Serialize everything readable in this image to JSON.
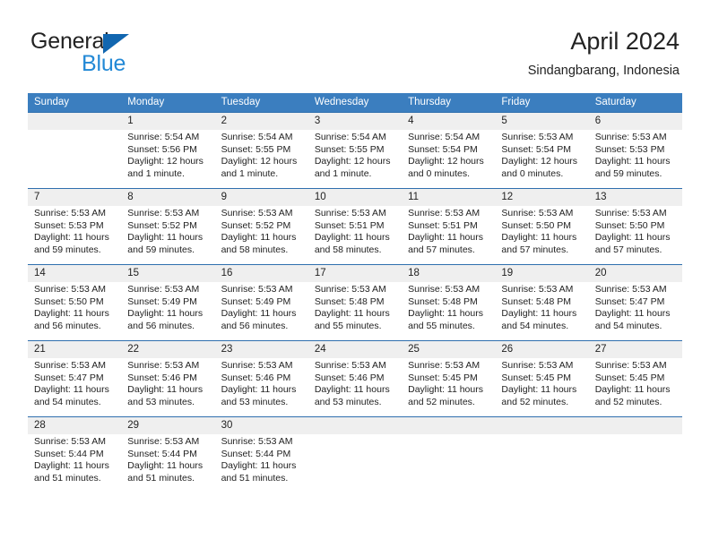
{
  "brand": {
    "line1": "General",
    "line2": "Blue",
    "triangle_color": "#1166b0",
    "blue_text_color": "#2389d6"
  },
  "header": {
    "title": "April 2024",
    "subtitle": "Sindangbarang, Indonesia"
  },
  "theme": {
    "header_row_bg": "#3b7ebf",
    "header_row_text": "#ffffff",
    "row_divider": "#2f6fae",
    "daynum_bg": "#efefef",
    "body_text": "#222222"
  },
  "weekdays": [
    "Sunday",
    "Monday",
    "Tuesday",
    "Wednesday",
    "Thursday",
    "Friday",
    "Saturday"
  ],
  "weeks": [
    [
      {
        "day": "",
        "blank": true,
        "sunrise": "",
        "sunset": "",
        "daylight_a": "",
        "daylight_b": ""
      },
      {
        "day": "1",
        "blank": false,
        "sunrise": "Sunrise: 5:54 AM",
        "sunset": "Sunset: 5:56 PM",
        "daylight_a": "Daylight: 12 hours",
        "daylight_b": "and 1 minute."
      },
      {
        "day": "2",
        "blank": false,
        "sunrise": "Sunrise: 5:54 AM",
        "sunset": "Sunset: 5:55 PM",
        "daylight_a": "Daylight: 12 hours",
        "daylight_b": "and 1 minute."
      },
      {
        "day": "3",
        "blank": false,
        "sunrise": "Sunrise: 5:54 AM",
        "sunset": "Sunset: 5:55 PM",
        "daylight_a": "Daylight: 12 hours",
        "daylight_b": "and 1 minute."
      },
      {
        "day": "4",
        "blank": false,
        "sunrise": "Sunrise: 5:54 AM",
        "sunset": "Sunset: 5:54 PM",
        "daylight_a": "Daylight: 12 hours",
        "daylight_b": "and 0 minutes."
      },
      {
        "day": "5",
        "blank": false,
        "sunrise": "Sunrise: 5:53 AM",
        "sunset": "Sunset: 5:54 PM",
        "daylight_a": "Daylight: 12 hours",
        "daylight_b": "and 0 minutes."
      },
      {
        "day": "6",
        "blank": false,
        "sunrise": "Sunrise: 5:53 AM",
        "sunset": "Sunset: 5:53 PM",
        "daylight_a": "Daylight: 11 hours",
        "daylight_b": "and 59 minutes."
      }
    ],
    [
      {
        "day": "7",
        "blank": false,
        "sunrise": "Sunrise: 5:53 AM",
        "sunset": "Sunset: 5:53 PM",
        "daylight_a": "Daylight: 11 hours",
        "daylight_b": "and 59 minutes."
      },
      {
        "day": "8",
        "blank": false,
        "sunrise": "Sunrise: 5:53 AM",
        "sunset": "Sunset: 5:52 PM",
        "daylight_a": "Daylight: 11 hours",
        "daylight_b": "and 59 minutes."
      },
      {
        "day": "9",
        "blank": false,
        "sunrise": "Sunrise: 5:53 AM",
        "sunset": "Sunset: 5:52 PM",
        "daylight_a": "Daylight: 11 hours",
        "daylight_b": "and 58 minutes."
      },
      {
        "day": "10",
        "blank": false,
        "sunrise": "Sunrise: 5:53 AM",
        "sunset": "Sunset: 5:51 PM",
        "daylight_a": "Daylight: 11 hours",
        "daylight_b": "and 58 minutes."
      },
      {
        "day": "11",
        "blank": false,
        "sunrise": "Sunrise: 5:53 AM",
        "sunset": "Sunset: 5:51 PM",
        "daylight_a": "Daylight: 11 hours",
        "daylight_b": "and 57 minutes."
      },
      {
        "day": "12",
        "blank": false,
        "sunrise": "Sunrise: 5:53 AM",
        "sunset": "Sunset: 5:50 PM",
        "daylight_a": "Daylight: 11 hours",
        "daylight_b": "and 57 minutes."
      },
      {
        "day": "13",
        "blank": false,
        "sunrise": "Sunrise: 5:53 AM",
        "sunset": "Sunset: 5:50 PM",
        "daylight_a": "Daylight: 11 hours",
        "daylight_b": "and 57 minutes."
      }
    ],
    [
      {
        "day": "14",
        "blank": false,
        "sunrise": "Sunrise: 5:53 AM",
        "sunset": "Sunset: 5:50 PM",
        "daylight_a": "Daylight: 11 hours",
        "daylight_b": "and 56 minutes."
      },
      {
        "day": "15",
        "blank": false,
        "sunrise": "Sunrise: 5:53 AM",
        "sunset": "Sunset: 5:49 PM",
        "daylight_a": "Daylight: 11 hours",
        "daylight_b": "and 56 minutes."
      },
      {
        "day": "16",
        "blank": false,
        "sunrise": "Sunrise: 5:53 AM",
        "sunset": "Sunset: 5:49 PM",
        "daylight_a": "Daylight: 11 hours",
        "daylight_b": "and 56 minutes."
      },
      {
        "day": "17",
        "blank": false,
        "sunrise": "Sunrise: 5:53 AM",
        "sunset": "Sunset: 5:48 PM",
        "daylight_a": "Daylight: 11 hours",
        "daylight_b": "and 55 minutes."
      },
      {
        "day": "18",
        "blank": false,
        "sunrise": "Sunrise: 5:53 AM",
        "sunset": "Sunset: 5:48 PM",
        "daylight_a": "Daylight: 11 hours",
        "daylight_b": "and 55 minutes."
      },
      {
        "day": "19",
        "blank": false,
        "sunrise": "Sunrise: 5:53 AM",
        "sunset": "Sunset: 5:48 PM",
        "daylight_a": "Daylight: 11 hours",
        "daylight_b": "and 54 minutes."
      },
      {
        "day": "20",
        "blank": false,
        "sunrise": "Sunrise: 5:53 AM",
        "sunset": "Sunset: 5:47 PM",
        "daylight_a": "Daylight: 11 hours",
        "daylight_b": "and 54 minutes."
      }
    ],
    [
      {
        "day": "21",
        "blank": false,
        "sunrise": "Sunrise: 5:53 AM",
        "sunset": "Sunset: 5:47 PM",
        "daylight_a": "Daylight: 11 hours",
        "daylight_b": "and 54 minutes."
      },
      {
        "day": "22",
        "blank": false,
        "sunrise": "Sunrise: 5:53 AM",
        "sunset": "Sunset: 5:46 PM",
        "daylight_a": "Daylight: 11 hours",
        "daylight_b": "and 53 minutes."
      },
      {
        "day": "23",
        "blank": false,
        "sunrise": "Sunrise: 5:53 AM",
        "sunset": "Sunset: 5:46 PM",
        "daylight_a": "Daylight: 11 hours",
        "daylight_b": "and 53 minutes."
      },
      {
        "day": "24",
        "blank": false,
        "sunrise": "Sunrise: 5:53 AM",
        "sunset": "Sunset: 5:46 PM",
        "daylight_a": "Daylight: 11 hours",
        "daylight_b": "and 53 minutes."
      },
      {
        "day": "25",
        "blank": false,
        "sunrise": "Sunrise: 5:53 AM",
        "sunset": "Sunset: 5:45 PM",
        "daylight_a": "Daylight: 11 hours",
        "daylight_b": "and 52 minutes."
      },
      {
        "day": "26",
        "blank": false,
        "sunrise": "Sunrise: 5:53 AM",
        "sunset": "Sunset: 5:45 PM",
        "daylight_a": "Daylight: 11 hours",
        "daylight_b": "and 52 minutes."
      },
      {
        "day": "27",
        "blank": false,
        "sunrise": "Sunrise: 5:53 AM",
        "sunset": "Sunset: 5:45 PM",
        "daylight_a": "Daylight: 11 hours",
        "daylight_b": "and 52 minutes."
      }
    ],
    [
      {
        "day": "28",
        "blank": false,
        "sunrise": "Sunrise: 5:53 AM",
        "sunset": "Sunset: 5:44 PM",
        "daylight_a": "Daylight: 11 hours",
        "daylight_b": "and 51 minutes."
      },
      {
        "day": "29",
        "blank": false,
        "sunrise": "Sunrise: 5:53 AM",
        "sunset": "Sunset: 5:44 PM",
        "daylight_a": "Daylight: 11 hours",
        "daylight_b": "and 51 minutes."
      },
      {
        "day": "30",
        "blank": false,
        "sunrise": "Sunrise: 5:53 AM",
        "sunset": "Sunset: 5:44 PM",
        "daylight_a": "Daylight: 11 hours",
        "daylight_b": "and 51 minutes."
      },
      {
        "day": "",
        "blank": true,
        "sunrise": "",
        "sunset": "",
        "daylight_a": "",
        "daylight_b": ""
      },
      {
        "day": "",
        "blank": true,
        "sunrise": "",
        "sunset": "",
        "daylight_a": "",
        "daylight_b": ""
      },
      {
        "day": "",
        "blank": true,
        "sunrise": "",
        "sunset": "",
        "daylight_a": "",
        "daylight_b": ""
      },
      {
        "day": "",
        "blank": true,
        "sunrise": "",
        "sunset": "",
        "daylight_a": "",
        "daylight_b": ""
      }
    ]
  ]
}
